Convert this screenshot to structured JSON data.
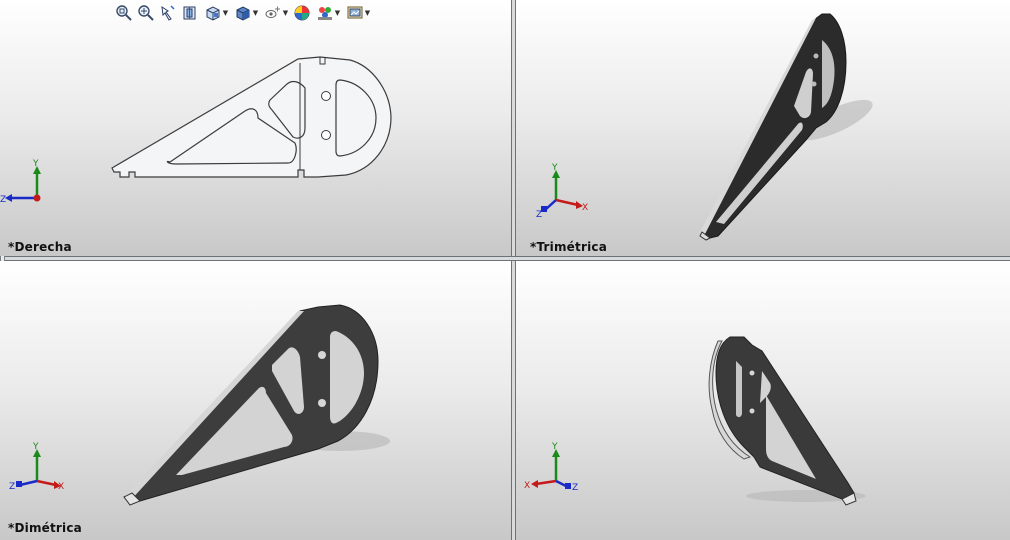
{
  "viewports": {
    "top_left": {
      "label": "*Derecha"
    },
    "top_right": {
      "label": "*Trimétrica"
    },
    "bottom_left": {
      "label": "*Dimétrica"
    },
    "bottom_right": {
      "label": ""
    }
  },
  "toolbar": {
    "icons": [
      "zoom-to-fit-icon",
      "zoom-to-area-icon",
      "previous-view-icon",
      "section-view-icon",
      "view-orientation-icon",
      "display-style-icon",
      "hide-show-items-icon",
      "edit-appearance-icon",
      "apply-scene-icon",
      "view-settings-icon"
    ]
  },
  "axes": {
    "x": "X",
    "y": "Y",
    "z": "Z"
  },
  "colors": {
    "part_flat": "#f3f5f7",
    "part_shaded": "#3a3a3a",
    "x_axis": "#c41a1a",
    "y_axis": "#1a8a1a",
    "z_axis": "#1a2ac8"
  }
}
